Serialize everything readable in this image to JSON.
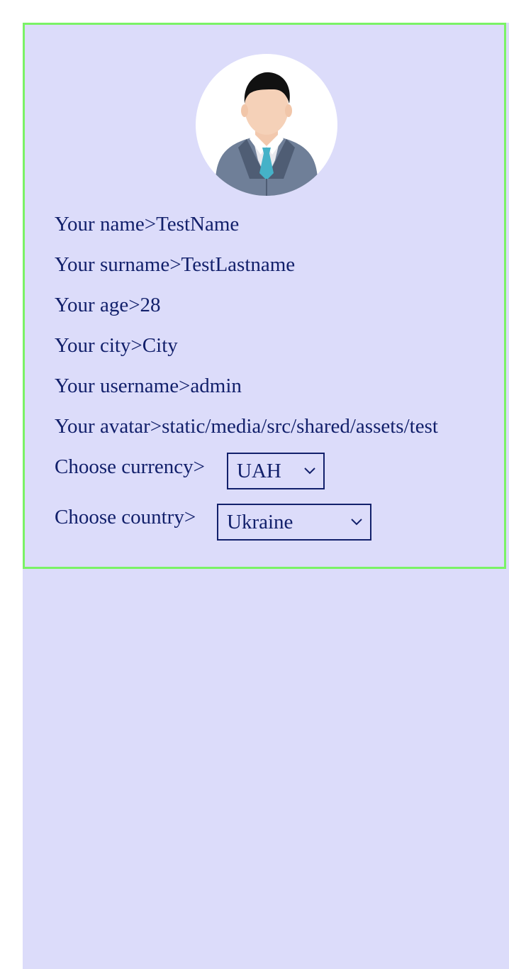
{
  "profile": {
    "name_label": "Your name>",
    "name_value": "TestName",
    "surname_label": "Your surname>",
    "surname_value": "TestLastname",
    "age_label": "Your age>",
    "age_value": "28",
    "city_label": "Your city>",
    "city_value": "City",
    "username_label": "Your username>",
    "username_value": "admin",
    "avatar_label": "Your avatar>",
    "avatar_value": "static/media/src/shared/assets/test"
  },
  "currency": {
    "label": "Choose currency>",
    "selected": "UAH"
  },
  "country": {
    "label": "Choose country>",
    "selected": "Ukraine"
  },
  "colors": {
    "background": "#dcdcfa",
    "card_border": "#7af266",
    "text": "#12206b"
  },
  "icons": {
    "avatar": "user-avatar-icon",
    "dropdown": "chevron-down-icon"
  }
}
